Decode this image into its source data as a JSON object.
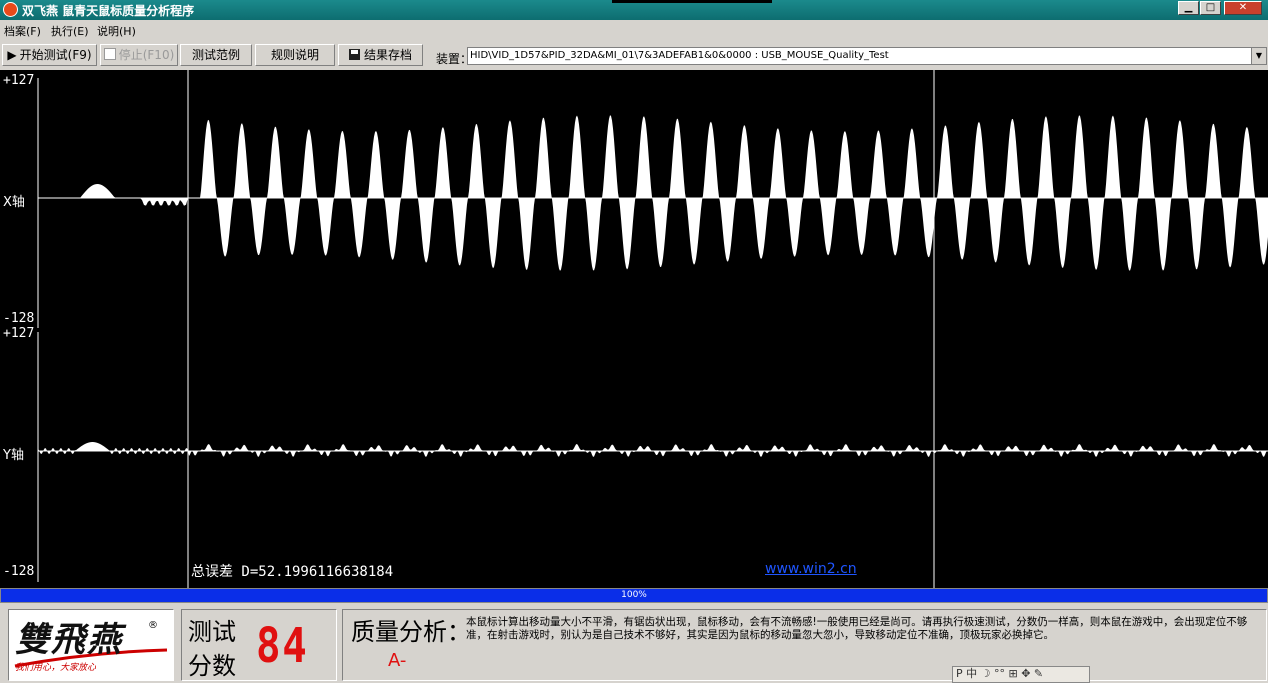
{
  "window": {
    "title": "双飞燕 鼠青天鼠标质量分析程序",
    "controls": {
      "minimize": "▁",
      "maximize": "□",
      "close": "✕"
    }
  },
  "menu": [
    "档案(F)",
    "执行(E)",
    "说明(H)"
  ],
  "toolbar": {
    "start": "开始测试(F9)",
    "stop": "停止(F10)",
    "examples": "测试范例",
    "rules": "规则说明",
    "save": "结果存档",
    "device_label": "装置：",
    "device_value": "HID\\VID_1D57&PID_32DA&MI_01\\7&3ADEFAB1&0&0000 : USB_MOUSE_Quality_Test"
  },
  "plot": {
    "x_axis": {
      "label": "X轴",
      "max": "+127",
      "min": "-128"
    },
    "y_axis": {
      "label": "Y轴",
      "max": "+127",
      "min": "-128"
    },
    "error_text": "总误差  D=52.1996116638184",
    "website": "www.win2.cn"
  },
  "progress": "100%",
  "logo": {
    "brand": "雙飛燕",
    "reg": "®",
    "slogan": "我们用心，大家放心"
  },
  "score": {
    "label1": "测试",
    "label2": "分数",
    "value": "84"
  },
  "quality": {
    "title": "质量分析：",
    "grade": "A-",
    "description": "本鼠标计算出移动量大小不平滑，有锯齿状出现，鼠标移动，会有不流畅感!一般使用已经是尚可。请再执行极速测试，分数仍一样高，则本鼠在游戏中，会出现定位不够准，在射击游戏时，别认为是自己技术不够好，其实是因为鼠标的移动量忽大忽小，导致移动定位不准确，顶极玩家必换掉它。"
  },
  "ime_bar": "P 中 ☽ °° ⊞ ✥ ✎",
  "colors": {
    "plot_bg": "#000000",
    "signal": "#ffffff",
    "progress": "#0a2ee8",
    "accent_red": "#e01010",
    "link": "#1f55ff"
  }
}
